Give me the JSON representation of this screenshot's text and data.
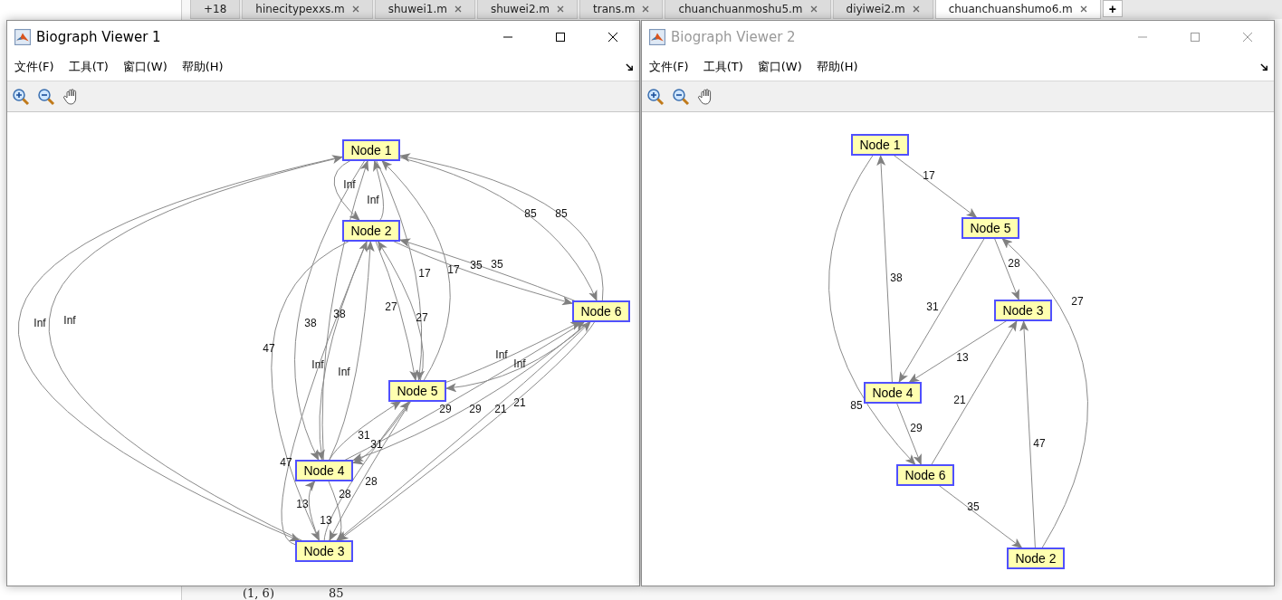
{
  "editor": {
    "tabs": [
      {
        "label": "+18",
        "selected": false
      },
      {
        "label": "hinecitypexxs.m",
        "selected": false
      },
      {
        "label": "shuwei1.m",
        "selected": false
      },
      {
        "label": "shuwei2.m",
        "selected": false
      },
      {
        "label": "trans.m",
        "selected": false
      },
      {
        "label": "chuanchuanmoshu5.m",
        "selected": false
      },
      {
        "label": "diyiwei2.m",
        "selected": false
      },
      {
        "label": "chuanchuanshumo6.m",
        "selected": true
      }
    ],
    "new_tab": "+",
    "output_row": [
      "(1, 6)",
      "85"
    ]
  },
  "windows": [
    {
      "title": "Biograph Viewer 1",
      "active": true,
      "menus": [
        "文件(F)",
        "工具(T)",
        "窗口(W)",
        "帮助(H)"
      ],
      "graph": {
        "nodes": [
          {
            "label": "Node 1"
          },
          {
            "label": "Node 2"
          },
          {
            "label": "Node 3"
          },
          {
            "label": "Node 4"
          },
          {
            "label": "Node 5"
          },
          {
            "label": "Node 6"
          }
        ],
        "edges": [
          {
            "label": "Inf"
          },
          {
            "label": "Inf"
          },
          {
            "label": "Inf"
          },
          {
            "label": "Inf"
          },
          {
            "label": "38"
          },
          {
            "label": "38"
          },
          {
            "label": "17"
          },
          {
            "label": "17"
          },
          {
            "label": "85"
          },
          {
            "label": "85"
          },
          {
            "label": "47"
          },
          {
            "label": "47"
          },
          {
            "label": "Inf"
          },
          {
            "label": "Inf"
          },
          {
            "label": "27"
          },
          {
            "label": "27"
          },
          {
            "label": "35"
          },
          {
            "label": "35"
          },
          {
            "label": "13"
          },
          {
            "label": "13"
          },
          {
            "label": "28"
          },
          {
            "label": "28"
          },
          {
            "label": "21"
          },
          {
            "label": "21"
          },
          {
            "label": "31"
          },
          {
            "label": "31"
          },
          {
            "label": "29"
          },
          {
            "label": "29"
          },
          {
            "label": "Inf"
          },
          {
            "label": "Inf"
          }
        ]
      }
    },
    {
      "title": "Biograph Viewer 2",
      "active": false,
      "menus": [
        "文件(F)",
        "工具(T)",
        "窗口(W)",
        "帮助(H)"
      ],
      "graph": {
        "nodes": [
          {
            "label": "Node 1"
          },
          {
            "label": "Node 2"
          },
          {
            "label": "Node 3"
          },
          {
            "label": "Node 4"
          },
          {
            "label": "Node 5"
          },
          {
            "label": "Node 6"
          }
        ],
        "edges": [
          {
            "label": "17"
          },
          {
            "label": "28"
          },
          {
            "label": "31"
          },
          {
            "label": "38"
          },
          {
            "label": "13"
          },
          {
            "label": "21"
          },
          {
            "label": "29"
          },
          {
            "label": "85"
          },
          {
            "label": "35"
          },
          {
            "label": "47"
          },
          {
            "label": "27"
          }
        ]
      }
    }
  ]
}
